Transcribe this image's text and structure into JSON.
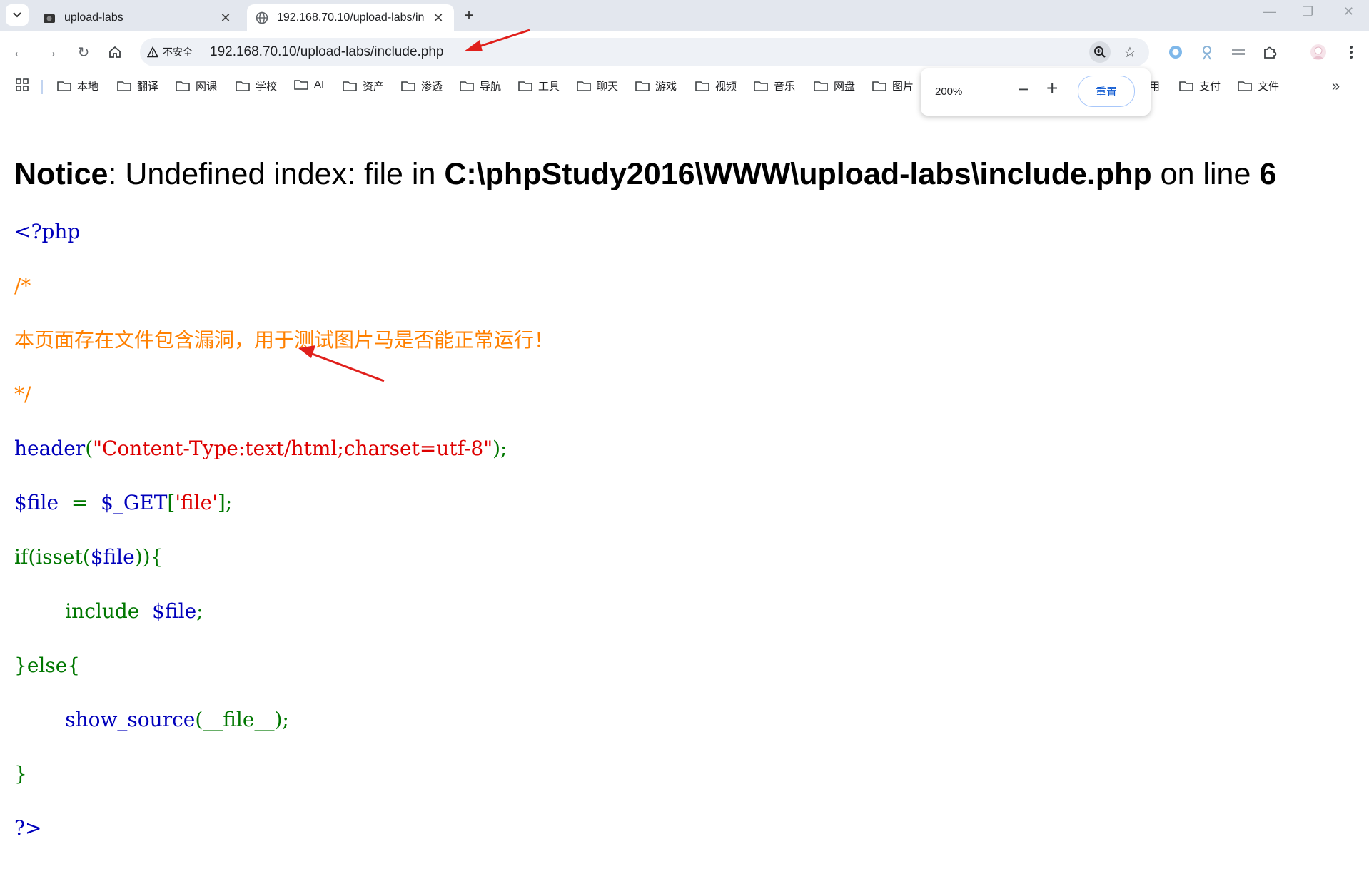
{
  "browser": {
    "tabs": [
      {
        "title": "upload-labs",
        "active": false
      },
      {
        "title": "192.168.70.10/upload-labs/in",
        "active": true
      }
    ],
    "security_label": "不安全",
    "url": "192.168.70.10/upload-labs/include.php",
    "bookmarks": [
      "本地",
      "翻译",
      "网课",
      "学校",
      "AI",
      "资产",
      "渗透",
      "导航",
      "工具",
      "聊天",
      "游戏",
      "视频",
      "音乐",
      "网盘",
      "图片",
      "用",
      "支付",
      "文件"
    ],
    "zoom": {
      "level": "200%",
      "reset_label": "重置"
    }
  },
  "page": {
    "notice": {
      "prefix": "Notice",
      "message": ": Undefined index: file in ",
      "path": "C:\\phpStudy2016\\WWW\\upload-labs\\include.php",
      "middle": " on line ",
      "line": "6"
    },
    "code": {
      "l1": "<?php",
      "l2": "/*",
      "l3": "本页面存在文件包含漏洞，用于测试图片马是否能正常运行！",
      "l4": "*/",
      "l5_fn": "header",
      "l5_open": "(",
      "l5_str": "\"Content-Type:text/html;charset=utf-8\"",
      "l5_close": ");",
      "l6_var": "$file",
      "l6_eq": "  =  ",
      "l6_get": "$_GET",
      "l6_br1": "[",
      "l6_str": "'file'",
      "l6_br2": "];",
      "l7_if": "if(isset(",
      "l7_var": "$file",
      "l7_close": ")){",
      "l8_indent": "        ",
      "l8_inc": "include  ",
      "l8_var": "$file",
      "l8_semi": ";",
      "l9": "}else{",
      "l10_indent": "        ",
      "l10_fn": "show_source",
      "l10_args": "(__file__);",
      "l11": "}",
      "l12": "?>"
    }
  },
  "colors": {
    "keyword": "#0000bb",
    "comment": "#ff8000",
    "string": "#dd0000",
    "operator": "#007700",
    "arrow": "#e0201c"
  }
}
